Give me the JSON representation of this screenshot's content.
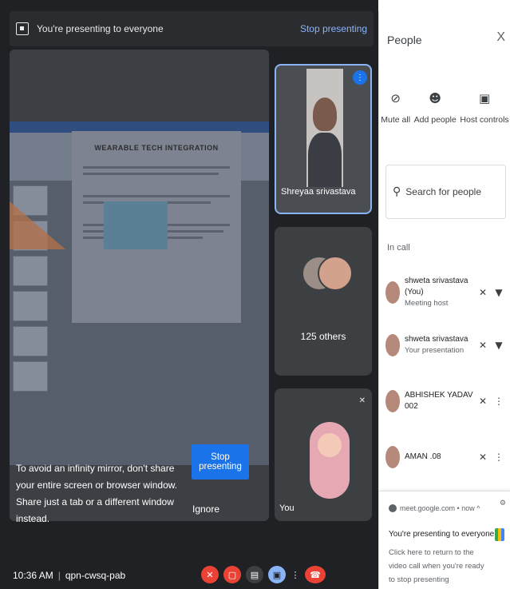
{
  "presenting_bar": {
    "message": "You're presenting to everyone",
    "stop_label": "Stop presenting"
  },
  "slide": {
    "title": "WEARABLE TECH INTEGRATION"
  },
  "overlay": {
    "message": "To avoid an infinity mirror, don't share your entire screen or browser window. Share just a tab or a different window instead.",
    "stop_button": "Stop presenting",
    "ignore_button": "Ignore"
  },
  "tiles": {
    "main_name": "Shreyaa srivastava",
    "others_label": "125 others",
    "self_label": "You"
  },
  "bottom_bar": {
    "time": "10:36 AM",
    "separator": "|",
    "meeting_code": "qpn-cwsq-pab"
  },
  "people_panel": {
    "title": "People",
    "close": "X",
    "actions": [
      {
        "label": "Mute all",
        "icon": "mic-off-icon"
      },
      {
        "label": "Add people",
        "icon": "person-add-icon"
      },
      {
        "label": "Host controls",
        "icon": "lock-icon"
      }
    ],
    "search_placeholder": "Search for people",
    "in_call_label": "In call",
    "participants": [
      {
        "name": "shweta srivastava (You)",
        "role": "Meeting host"
      },
      {
        "name": "shweta srivastava",
        "role": "Your presentation"
      },
      {
        "name": "ABHISHEK YADAV 002",
        "role": ""
      },
      {
        "name": "AMAN .08",
        "role": ""
      }
    ]
  },
  "notification": {
    "source": "meet.google.com • now ^",
    "title": "You're presenting to everyone",
    "body": "Click here to return to the video call when you're ready to stop presenting"
  },
  "colors": {
    "meet_background": "#202124",
    "accent_blue": "#1a73e8",
    "link_blue": "#8ab4f8",
    "end_call_red": "#ea4335"
  }
}
